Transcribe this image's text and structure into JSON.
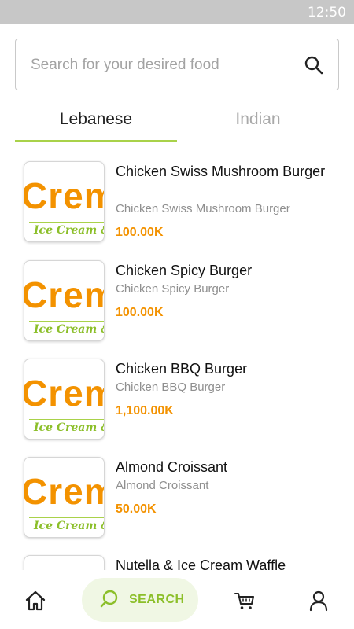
{
  "status_bar": {
    "time": "12:50"
  },
  "search": {
    "placeholder": "Search for your desired food",
    "icon": "search-icon"
  },
  "tabs": [
    {
      "label": "Lebanese",
      "active": true
    },
    {
      "label": "Indian",
      "active": false
    }
  ],
  "thumbnail": {
    "logo_text": "Crem",
    "script_text": "Ice Cream &"
  },
  "items": [
    {
      "name": "Chicken Swiss Mushroom Burger",
      "description": "Chicken Swiss Mushroom Burger",
      "price": "100.00K"
    },
    {
      "name": "Chicken Spicy Burger",
      "description": "Chicken Spicy Burger",
      "price": "100.00K"
    },
    {
      "name": "Chicken BBQ Burger",
      "description": "Chicken BBQ Burger",
      "price": "1,100.00K"
    },
    {
      "name": "Almond Croissant",
      "description": "Almond Croissant",
      "price": "50.00K"
    },
    {
      "name": "Nutella & Ice Cream Waffle",
      "description": "",
      "price": ""
    }
  ],
  "bottom_nav": {
    "home_icon": "home-icon",
    "search_label": "SEARCH",
    "cart_icon": "cart-icon",
    "profile_icon": "profile-icon"
  },
  "colors": {
    "accent_green": "#a9d24a",
    "price_orange": "#f39200",
    "status_bar": "#c7c7c7"
  }
}
